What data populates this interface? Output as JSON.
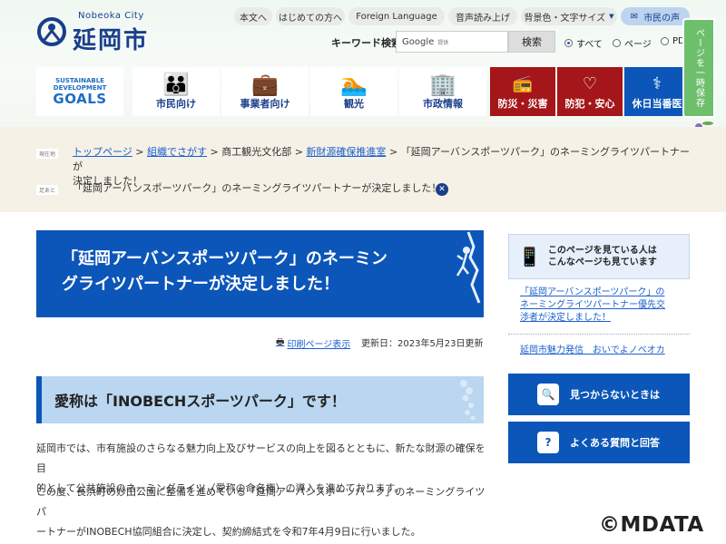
{
  "header": {
    "logo_en": "Nobeoka City",
    "logo_jp": "延岡市",
    "util_links": [
      "本文へ",
      "はじめての方へ",
      "Foreign Language",
      "音声読み上げ",
      "背景色・文字サイズ"
    ],
    "voice_button": "市民の声",
    "search": {
      "label": "キーワード検索",
      "google_text": "Google",
      "google_tiny": "提供",
      "button": "検索",
      "options": [
        "すべて",
        "ページ",
        "PDF"
      ]
    },
    "side_tab": "ページを一時保存"
  },
  "nav": {
    "sdg_line1": "SUSTAINABLE",
    "sdg_line2": "DEVELOPMENT",
    "sdg_goals": "GOALS",
    "items": [
      {
        "label": "市民向け",
        "icon": "people-icon"
      },
      {
        "label": "事業者向け",
        "icon": "business-icon"
      },
      {
        "label": "観光",
        "icon": "tourism-icon"
      },
      {
        "label": "市政情報",
        "icon": "cityhall-icon"
      },
      {
        "label": "防災・災害",
        "icon": "radio-icon"
      },
      {
        "label": "防犯・安心",
        "icon": "heart-icon"
      },
      {
        "label": "休日当番医",
        "icon": "stethoscope-icon"
      }
    ]
  },
  "breadcrumb": {
    "current_tag": "現在地",
    "crumbs": [
      "トップページ",
      "組織でさがす",
      "商工観光文化部",
      "新財源確保推進室"
    ],
    "current_title_line1": "「延岡アーバンスポーツパーク」のネーミングライツパートナーが",
    "current_title_line2": "決定しました！",
    "history_tag": "足あと",
    "history_item": "「延岡アーバンスポーツパーク」のネーミングライツパートナーが決定しました！"
  },
  "main": {
    "title_line1": "「延岡アーバンスポーツパーク」のネーミン",
    "title_line2": "グライツパートナーが決定しました！",
    "print_label": "印刷ページ表示",
    "updated": "更新日：2023年5月23日更新",
    "heading": "愛称は「INOBECHスポーツパーク」です！",
    "para1_line1": "延岡市では、市有施設のさらなる魅力向上及びサービスの向上を図るとともに、新たな財源の確保を目",
    "para1_line2": "的として公共施設のネーミングライツ（愛称の命名権）の導入を進めております。",
    "para2_line1": "この度、長浜町の妙田公園に整備を進めている「延岡アーバンスポーツパーク」のネーミングライツパ",
    "para2_line2": "ートナーがINOBECH協同組合に決定し、契約締結式を令和7年4月9日に行いました。"
  },
  "sidebar": {
    "card_line1": "このページを見ている人は",
    "card_line2": "こんなページも見ています",
    "link1_line1": "「延岡アーバンスポーツパーク」の",
    "link1_line2": "ネーミングライツパートナー優先交",
    "link1_line3": "渉者が決定しました！",
    "link2": "延岡市魅力発信　おいでよノベオカ",
    "btn_notfound": "見つからないときは",
    "btn_faq": "よくある質問と回答"
  },
  "watermark": "©MDATA"
}
